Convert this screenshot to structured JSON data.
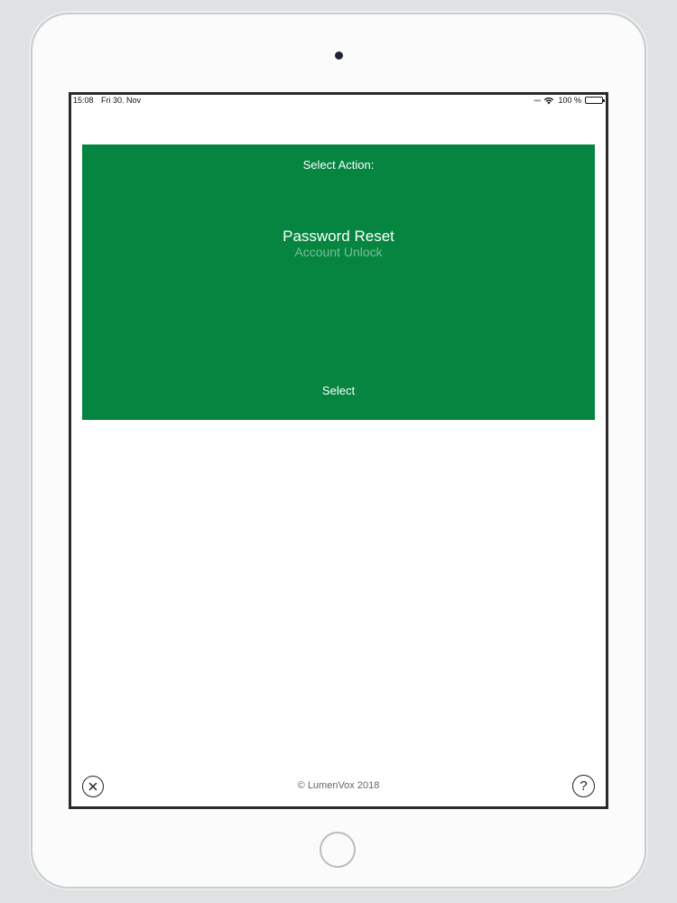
{
  "status_bar": {
    "time": "15:08",
    "date": "Fri 30. Nov",
    "battery": "100 %",
    "battery_level": 1.0
  },
  "action_panel": {
    "title": "Select Action:",
    "picker": {
      "selected": "Password Reset",
      "options": [
        "Password Reset",
        "Account Unlock"
      ]
    },
    "select_label": "Select",
    "background_color": "#058540"
  },
  "footer": {
    "copyright": "© LumenVox 2018",
    "close_icon": "close-circle-icon",
    "help_icon": "question-circle-icon",
    "help_glyph": "?"
  }
}
